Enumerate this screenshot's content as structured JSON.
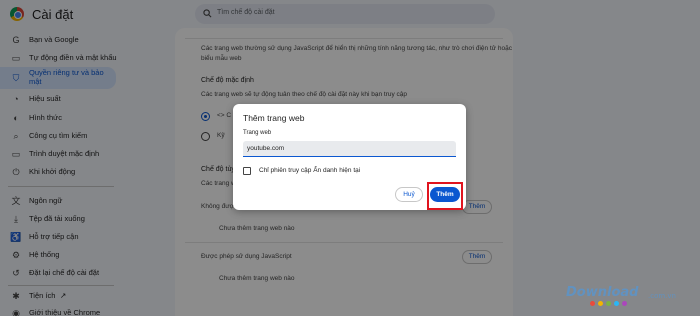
{
  "header": {
    "title": "Cài đặt",
    "search_placeholder": "Tìm chế độ cài đặt"
  },
  "sidebar": {
    "items": [
      {
        "label": "Bạn và Google",
        "icon": "G"
      },
      {
        "label": "Tự động điền và mật khẩu",
        "icon": "▭"
      },
      {
        "label": "Quyền riêng tư và bảo mật",
        "icon": "⛉",
        "active": true
      },
      {
        "label": "Hiệu suất",
        "icon": "◔"
      },
      {
        "label": "Hình thức",
        "icon": "◐"
      },
      {
        "label": "Công cụ tìm kiếm",
        "icon": "⌕"
      },
      {
        "label": "Trình duyệt mặc định",
        "icon": "▭"
      },
      {
        "label": "Khi khởi động",
        "icon": "⏻"
      },
      {
        "label": "Ngôn ngữ",
        "icon": "文"
      },
      {
        "label": "Tệp đã tải xuống",
        "icon": "⤓"
      },
      {
        "label": "Hỗ trợ tiếp cận",
        "icon": "♿"
      },
      {
        "label": "Hệ thống",
        "icon": "⚙"
      },
      {
        "label": "Đặt lại chế độ cài đặt",
        "icon": "↺"
      },
      {
        "label": "Tiện ích",
        "icon": "✱"
      },
      {
        "label": "Giới thiệu về Chrome",
        "icon": "◉"
      }
    ],
    "external_icon": "↗"
  },
  "main": {
    "top_text_line1": "Các trang web thường sử dụng JavaScript để hiển thị những tính năng tương tác, như trò chơi điện tử hoặc",
    "top_text_line2": "biểu mẫu web",
    "default_heading": "Chế độ mặc định",
    "default_desc": "Các trang web sẽ tự động tuân theo chế độ cài đặt này khi bạn truy cập",
    "option1": "<> C",
    "option2": "Kỹ",
    "custom_heading": "Chế độ tùy c",
    "custom_desc": "Các trang web",
    "not_allowed_label": "Không được",
    "add_label": "Thêm",
    "no_sites_1": "Chưa thêm trang web nào",
    "allowed_label": "Được phép sử dụng JavaScript",
    "add_label_2": "Thêm",
    "no_sites_2": "Chưa thêm trang web nào"
  },
  "dialog": {
    "title": "Thêm trang web",
    "field_label": "Trang web",
    "field_value": "youtube.com",
    "checkbox_label": "Chỉ phiên truy cập Ẩn danh hiện tại",
    "cancel_label": "Huỷ",
    "add_label": "Thêm"
  },
  "watermark": {
    "text": "Download",
    "suffix": ".com.vn"
  },
  "colors": {
    "accent": "#0b57d0",
    "highlight": "#e0141e",
    "active_bg": "#d3e3fd"
  }
}
